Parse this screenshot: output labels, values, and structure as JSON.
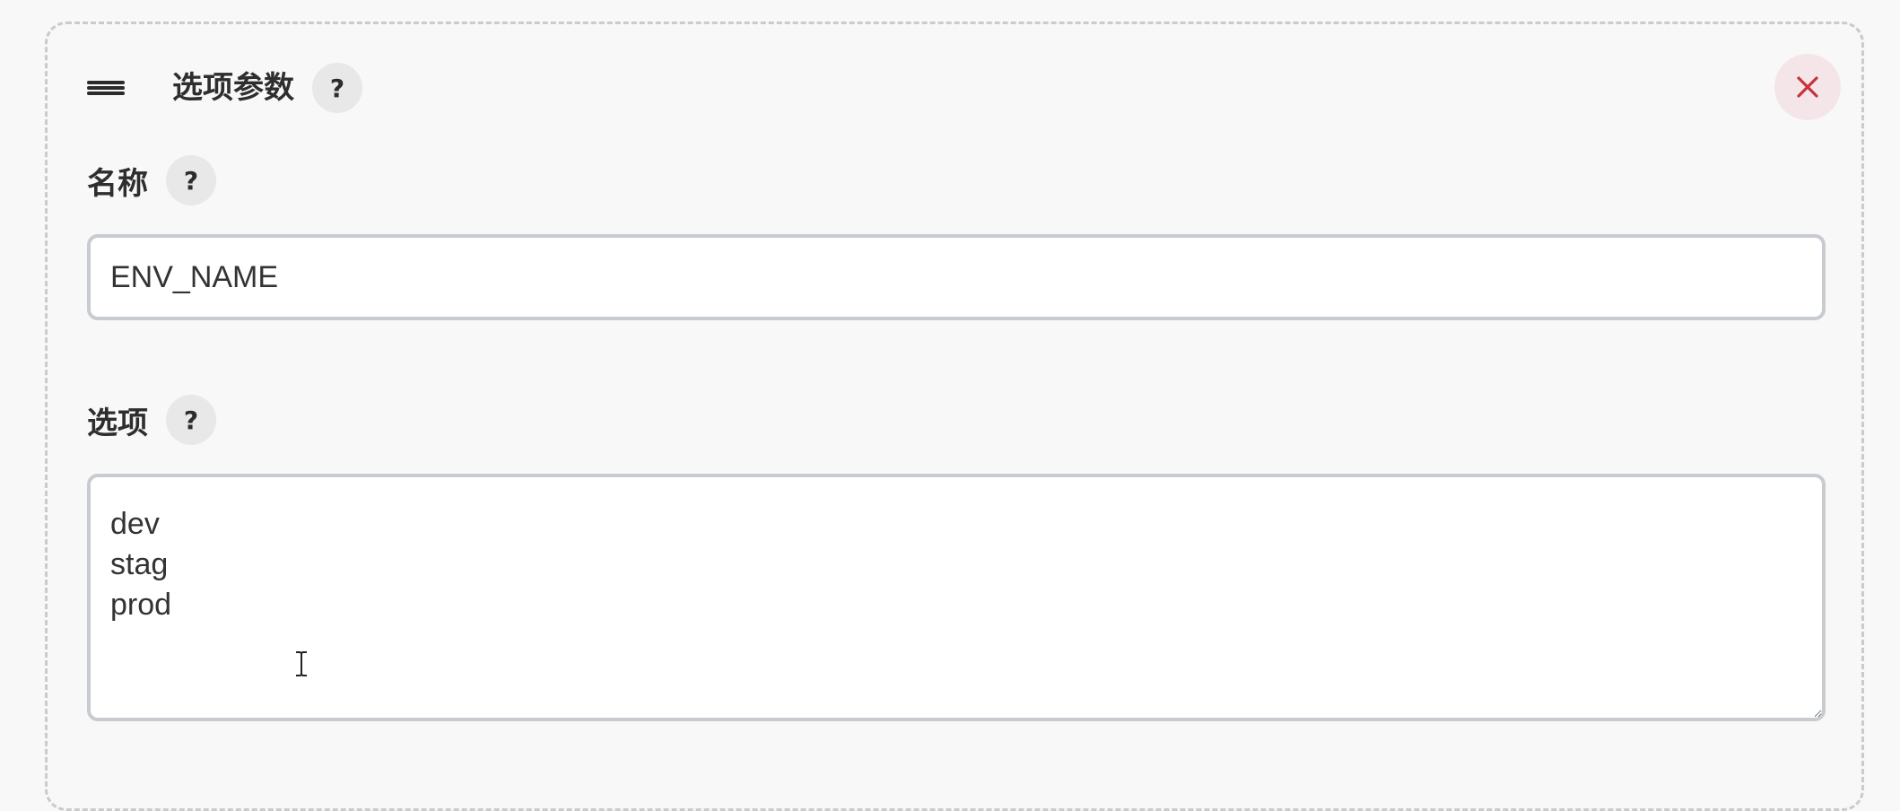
{
  "parameter_block": {
    "title": "选项参数",
    "help_label": "?",
    "icons": {
      "drag_handle": "hamburger-drag-icon",
      "close": "close-x-icon",
      "cursor": "text-cursor-icon"
    },
    "colors": {
      "close_icon": "#c8323c",
      "close_bg": "#f4e6e8",
      "border_dashed": "#c9cbcd"
    }
  },
  "name_field": {
    "label": "名称",
    "help_label": "?",
    "value": "ENV_NAME"
  },
  "choices_field": {
    "label": "选项",
    "help_label": "?",
    "value": "dev\nstag\nprod"
  }
}
